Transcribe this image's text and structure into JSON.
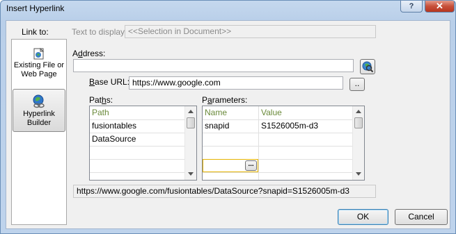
{
  "window": {
    "title": "Insert Hyperlink",
    "help_glyph": "?",
    "close_glyph": "✕"
  },
  "link_to": {
    "label": "Link to:",
    "items": [
      {
        "label_line1": "Existing File or",
        "label_line2": "Web Page",
        "icon": "globe-folder-icon"
      },
      {
        "label_line1": "Hyperlink",
        "label_line2": "Builder",
        "icon": "globe-chain-icon"
      }
    ]
  },
  "text_to_display": {
    "label": "Text to display:",
    "value": "<<Selection in Document>>"
  },
  "address": {
    "label_pre": "A",
    "label_ul": "d",
    "label_post": "dress:",
    "value": ""
  },
  "base_url": {
    "label_ul": "B",
    "label_post": "ase URL:",
    "value": "https://www.google.com",
    "browse": ".."
  },
  "paths": {
    "label_pre": "Pat",
    "label_ul": "h",
    "label_post": "s:",
    "header": "Path",
    "rows": [
      "fusiontables",
      "DataSource",
      "",
      ""
    ]
  },
  "parameters": {
    "label_pre": "P",
    "label_ul": "a",
    "label_post": "rameters:",
    "headers": [
      "Name",
      "Value"
    ],
    "rows": [
      [
        "snapid",
        "S1526005m-d3"
      ],
      [
        "",
        ""
      ],
      [
        "",
        ""
      ],
      [
        "",
        ""
      ]
    ],
    "cell_button": "..."
  },
  "result_url": "https://www.google.com/fusiontables/DataSource?snapid=S1526005m-d3",
  "buttons": {
    "ok": "OK",
    "cancel": "Cancel"
  },
  "colors": {
    "header_text": "#6a8a3a",
    "selected_cell_border": "#e5b400"
  }
}
